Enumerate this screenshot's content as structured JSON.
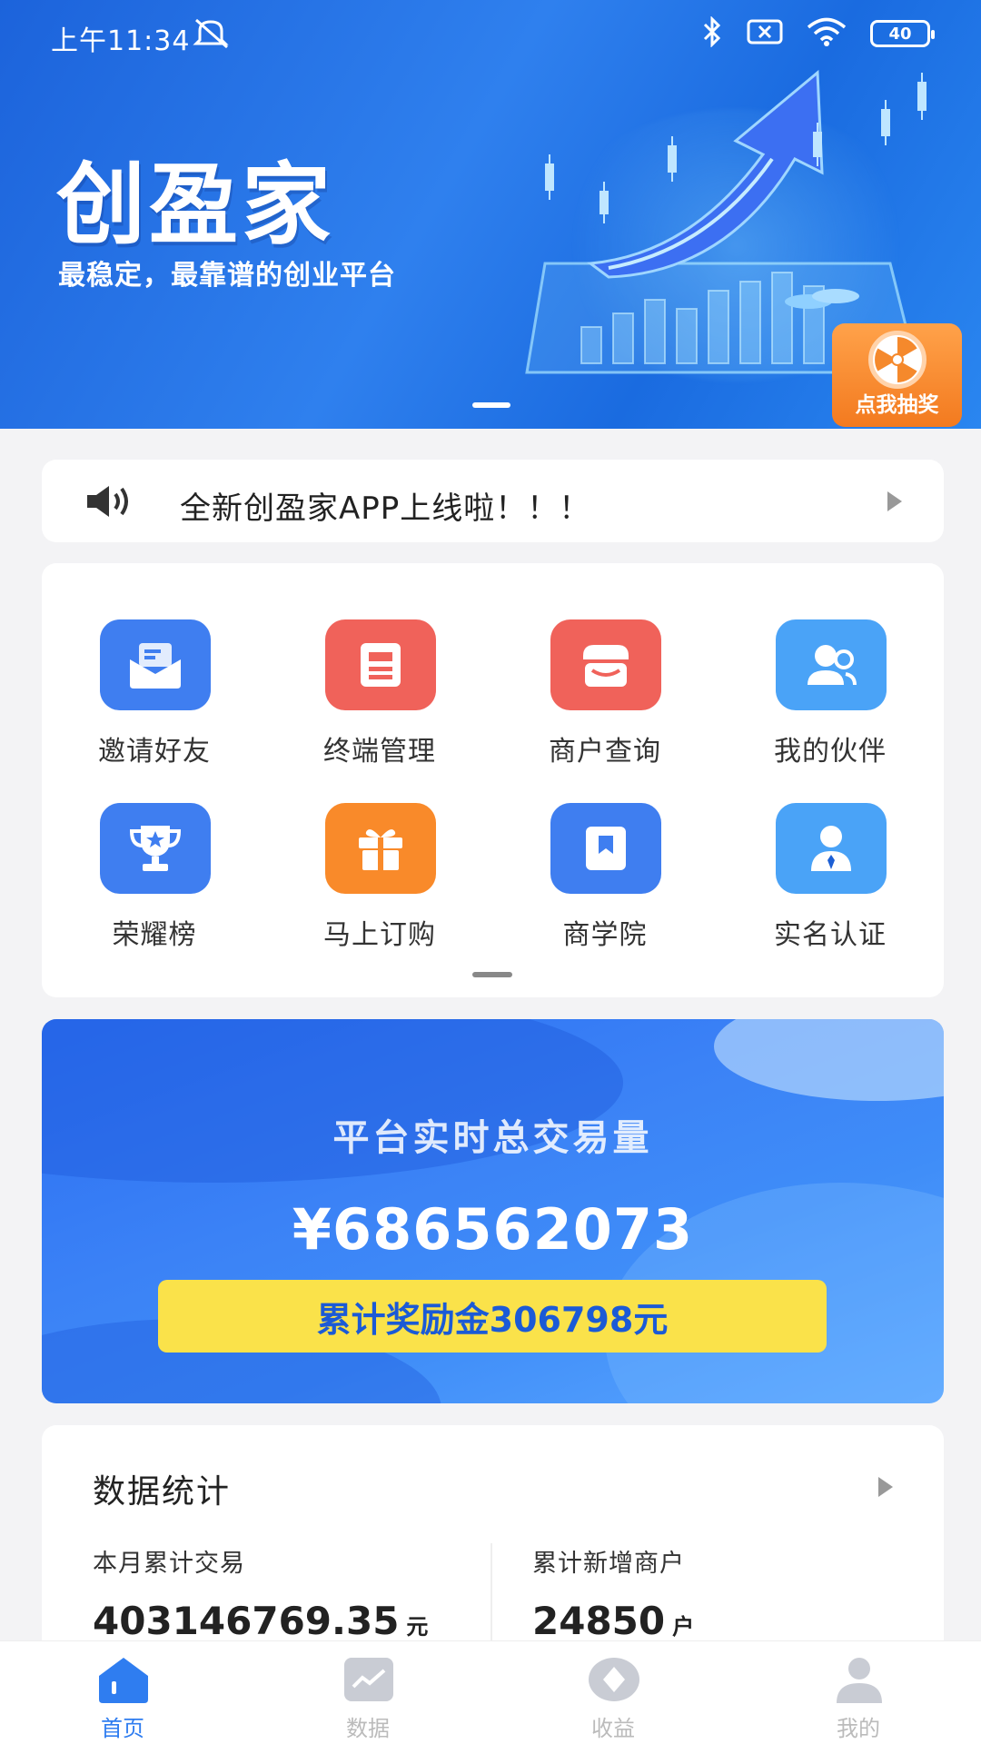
{
  "status_bar": {
    "time": "上午11:34",
    "battery": "40"
  },
  "banner": {
    "title": "创盈家",
    "subtitle": "最稳定，最靠谱的创业平台",
    "lottery_label": "点我抽奖"
  },
  "notice": {
    "text": "全新创盈家APP上线啦！！！"
  },
  "menu": {
    "items": [
      {
        "label": "邀请好友",
        "icon": "envelope-icon",
        "color": "#3f7ef0"
      },
      {
        "label": "终端管理",
        "icon": "terminal-icon",
        "color": "#f0625a"
      },
      {
        "label": "商户查询",
        "icon": "shop-icon",
        "color": "#f0625a"
      },
      {
        "label": "我的伙伴",
        "icon": "partners-icon",
        "color": "#4aa3f7"
      },
      {
        "label": "荣耀榜",
        "icon": "trophy-icon",
        "color": "#3f7ef0"
      },
      {
        "label": "马上订购",
        "icon": "gift-icon",
        "color": "#f98a2a"
      },
      {
        "label": "商学院",
        "icon": "book-icon",
        "color": "#3f7ef0"
      },
      {
        "label": "实名认证",
        "icon": "id-user-icon",
        "color": "#4aa3f7"
      }
    ]
  },
  "volume": {
    "title": "平台实时总交易量",
    "value": "¥686562073",
    "reward": "累计奖励金306798元"
  },
  "stats": {
    "title": "数据统计",
    "month_label": "本月累计交易",
    "month_value": "403146769.35",
    "month_unit": "元",
    "merchants_label": "累计新增商户",
    "merchants_value": "24850",
    "merchants_unit": "户"
  },
  "tabs": [
    {
      "label": "首页",
      "icon": "home-icon",
      "active": true
    },
    {
      "label": "数据",
      "icon": "chart-icon",
      "active": false
    },
    {
      "label": "收益",
      "icon": "earnings-icon",
      "active": false
    },
    {
      "label": "我的",
      "icon": "profile-icon",
      "active": false
    }
  ],
  "colors": {
    "primary": "#2f7df0",
    "accent_orange": "#f37a1f",
    "reward_yellow": "#fae24a",
    "tab_active": "#2f7df0",
    "tab_inactive": "#bbbbbb"
  }
}
